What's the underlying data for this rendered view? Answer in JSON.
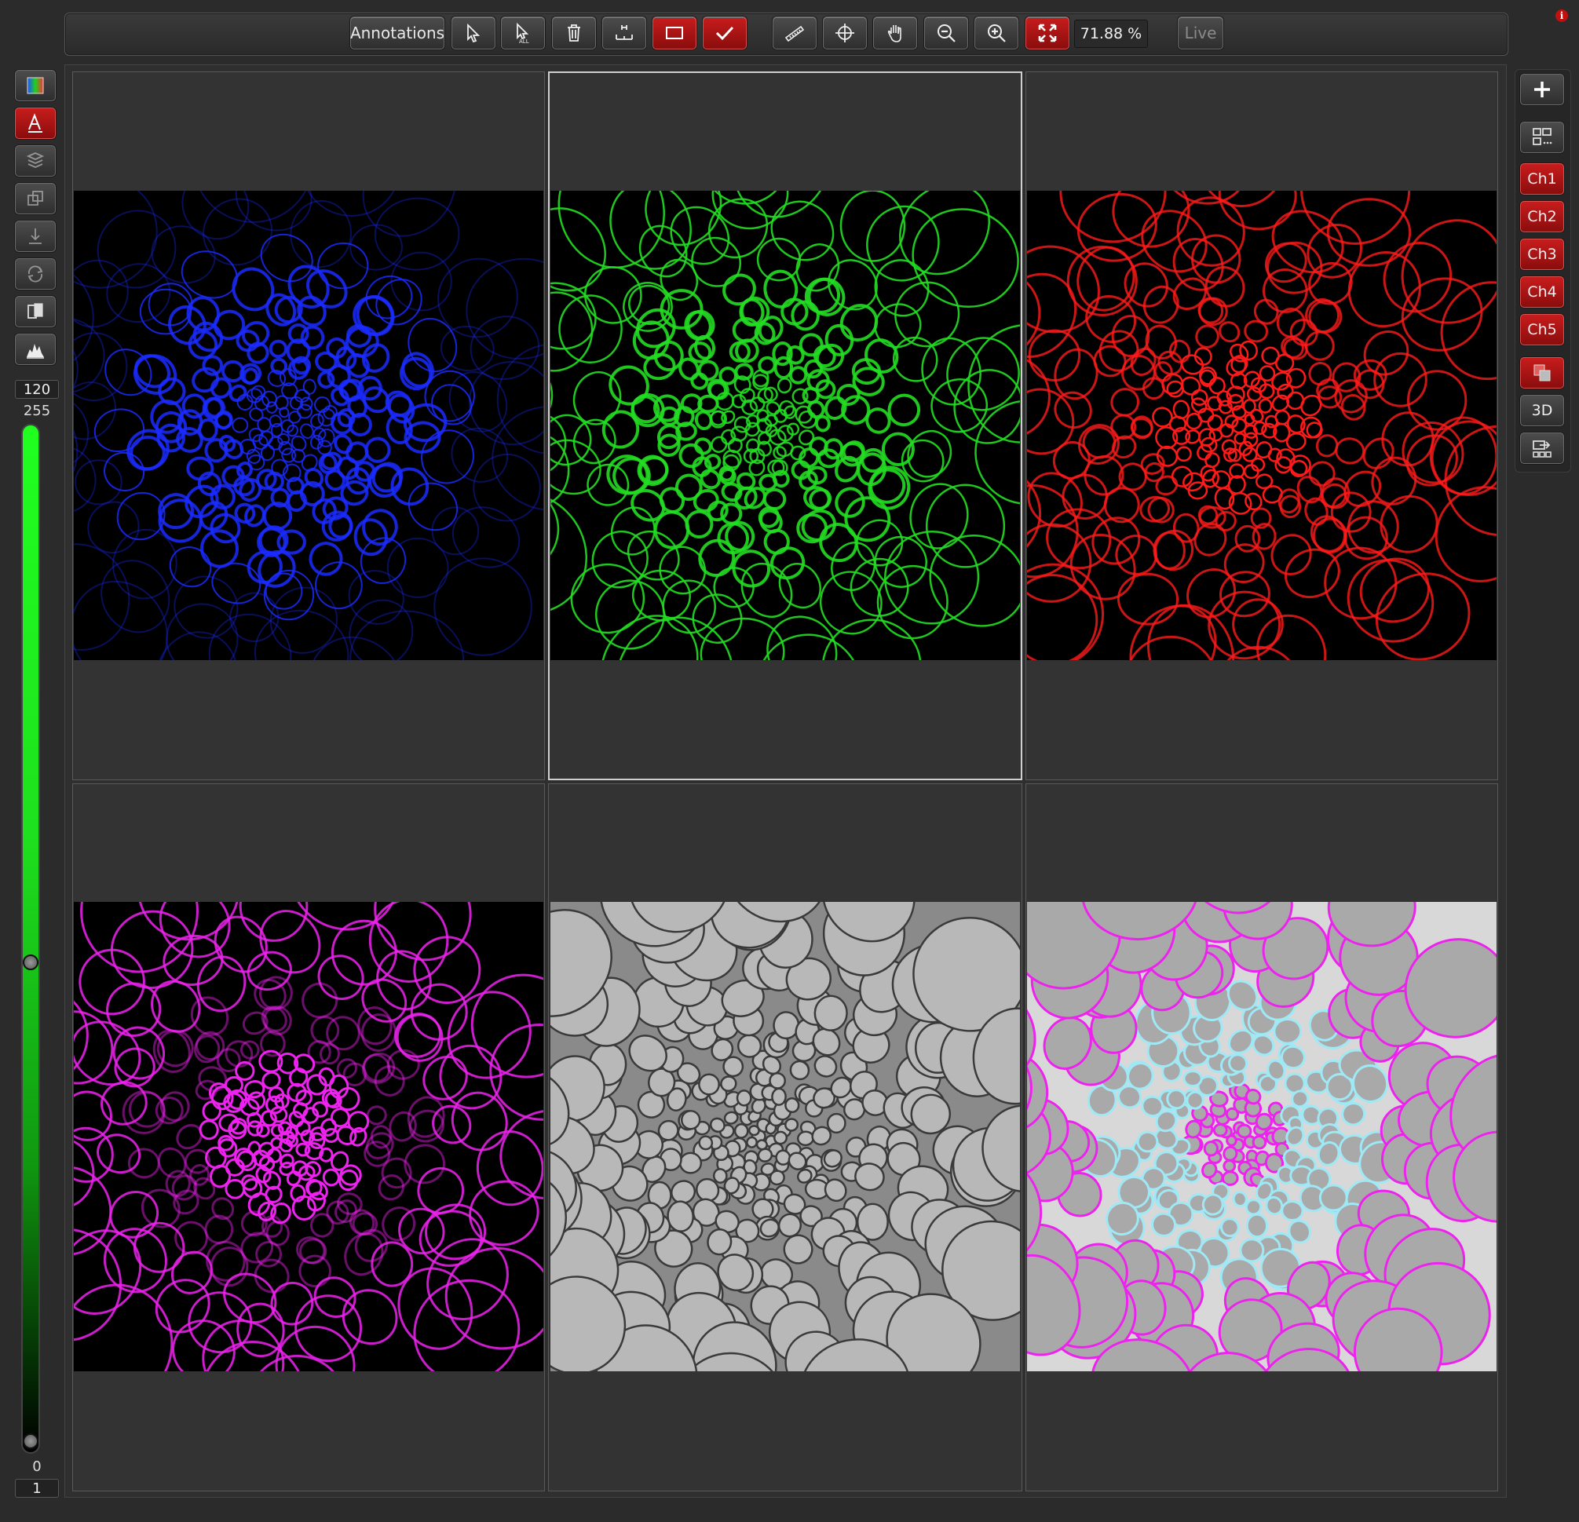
{
  "toolbar": {
    "annotations_label": "Annotations",
    "zoom_value": "71.88 %",
    "live_label": "Live"
  },
  "left_panel": {
    "level_value": "120",
    "max_label": "255",
    "min_label": "0",
    "step_value": "1"
  },
  "right_panel": {
    "channels": [
      "Ch1",
      "Ch2",
      "Ch3",
      "Ch4",
      "Ch5"
    ],
    "three_d_label": "3D"
  },
  "viewer": {
    "panels": [
      {
        "channel": "blue",
        "color": "#1a2cff"
      },
      {
        "channel": "green",
        "color": "#22dd22"
      },
      {
        "channel": "red",
        "color": "#ff1a1a"
      },
      {
        "channel": "magenta",
        "color": "#ee22ee"
      },
      {
        "channel": "brightfield",
        "color": "#bdbdbd"
      },
      {
        "channel": "merge",
        "color": "#f2f2f2"
      }
    ]
  },
  "colors": {
    "accent_red": "#c81c1c",
    "slider_green": "#20ff20",
    "background": "#2b2b2b"
  }
}
